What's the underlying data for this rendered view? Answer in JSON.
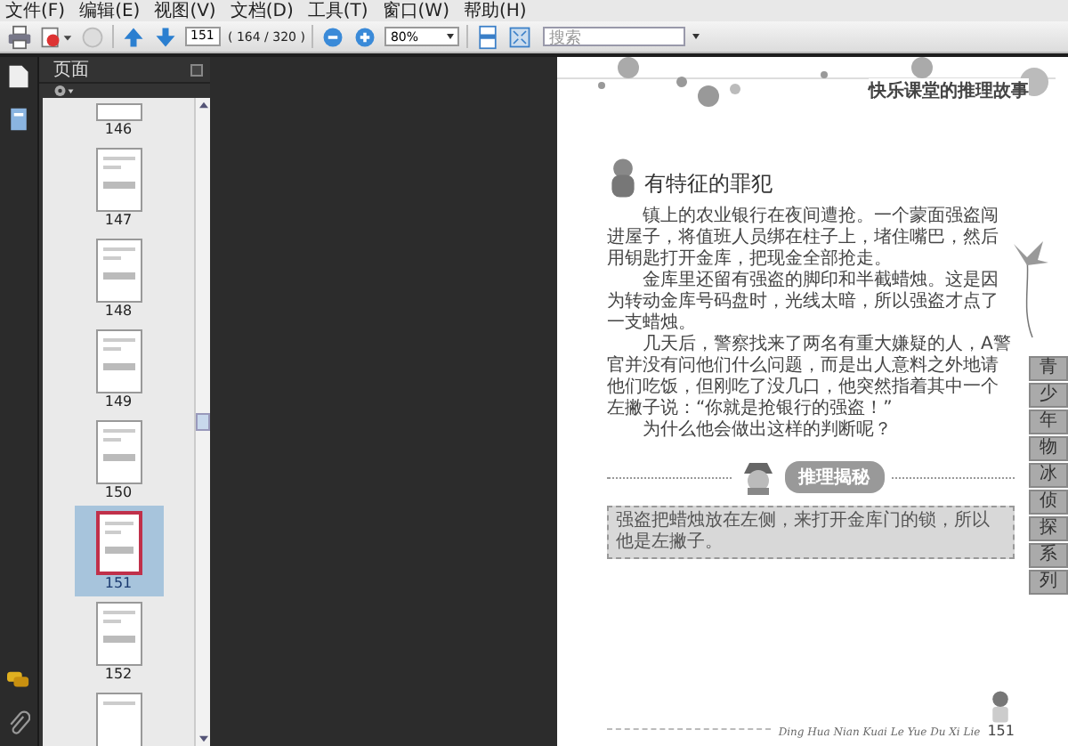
{
  "menu_bar": [
    "文件(F)",
    "编辑(E)",
    "视图(V)",
    "文档(D)",
    "工具(T)",
    "窗口(W)",
    "帮助(H)"
  ],
  "toolbar": {
    "page_number": "151",
    "page_count": "( 164 / 320 )",
    "zoom": "80%",
    "search": {
      "placeholder": "搜索"
    }
  },
  "pages_panel": {
    "title": "页面",
    "thumbnails": [
      {
        "label": "146",
        "selected": false
      },
      {
        "label": "147",
        "selected": false
      },
      {
        "label": "148",
        "selected": false
      },
      {
        "label": "149",
        "selected": false
      },
      {
        "label": "150",
        "selected": false
      },
      {
        "label": "151",
        "selected": true
      },
      {
        "label": "152",
        "selected": false
      }
    ]
  },
  "document_page": {
    "header_title": "快乐课堂的推理故事",
    "story_title": "有特征的罪犯",
    "paragraphs": [
      "镇上的农业银行在夜间遭抢。一个蒙面强盗闯进屋子，将值班人员绑在柱子上，堵住嘴巴，然后用钥匙打开金库，把现金全部抢走。",
      "金库里还留有强盗的脚印和半截蜡烛。这是因为转动金库号码盘时，光线太暗，所以强盗才点了一支蜡烛。",
      "几天后，警察找来了两名有重大嫌疑的人，A警官并没有问他们什么问题，而是出人意料之外地请他们吃饭，但刚吃了没几口，他突然指着其中一个左撇子说：“你就是抢银行的强盗！”",
      "为什么他会做出这样的判断呢？"
    ],
    "banner": "推理揭秘",
    "answer": "强盗把蜡烛放在左侧，来打开金库门的锁，所以他是左撇子。",
    "side_tabs": [
      "青",
      "少",
      "年",
      "物",
      "冰",
      "侦",
      "探",
      "系",
      "列"
    ],
    "footer": "Ding Hua Nian Kuai Le Yue Du Xi Lie",
    "page_number": "151"
  }
}
